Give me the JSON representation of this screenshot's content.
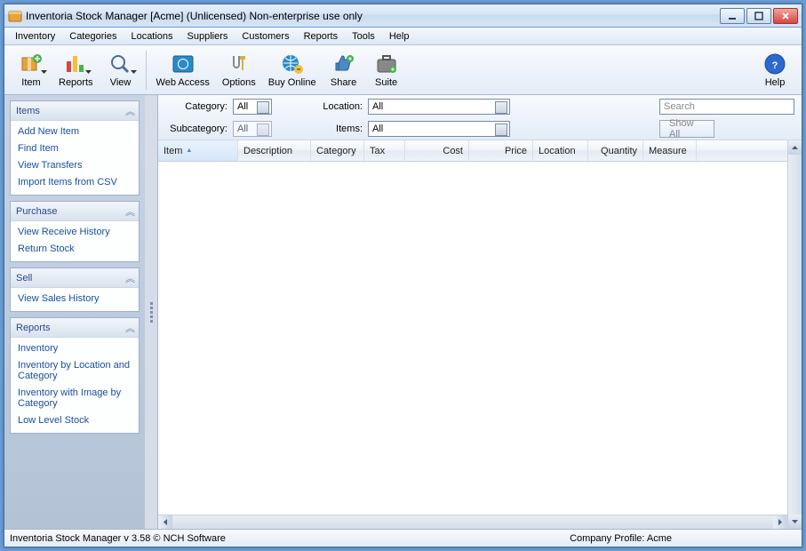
{
  "titlebar": {
    "text": "Inventoria Stock Manager [Acme] (Unlicensed) Non-enterprise use only"
  },
  "menubar": [
    "Inventory",
    "Categories",
    "Locations",
    "Suppliers",
    "Customers",
    "Reports",
    "Tools",
    "Help"
  ],
  "toolbar": {
    "item": "Item",
    "reports": "Reports",
    "view": "View",
    "web_access": "Web Access",
    "options": "Options",
    "buy_online": "Buy Online",
    "share": "Share",
    "suite": "Suite",
    "help": "Help"
  },
  "sidebar": {
    "items": {
      "title": "Items",
      "links": [
        "Add New Item",
        "Find Item",
        "View Transfers",
        "Import Items from CSV"
      ]
    },
    "purchase": {
      "title": "Purchase",
      "links": [
        "View Receive History",
        "Return Stock"
      ]
    },
    "sell": {
      "title": "Sell",
      "links": [
        "View Sales History"
      ]
    },
    "reports": {
      "title": "Reports",
      "links": [
        "Inventory",
        "Inventory by Location and Category",
        "Inventory with Image by Category",
        "Low Level Stock"
      ]
    }
  },
  "filters": {
    "category_label": "Category:",
    "category_value": "All",
    "location_label": "Location:",
    "location_value": "All",
    "subcategory_label": "Subcategory:",
    "subcategory_value": "All",
    "items_label": "Items:",
    "items_value": "All",
    "search_placeholder": "Search",
    "show_all": "Show All"
  },
  "grid": {
    "columns": [
      "Item",
      "Description",
      "Category",
      "Tax",
      "Cost",
      "Price",
      "Location",
      "Quantity",
      "Measure"
    ],
    "rows": []
  },
  "statusbar": {
    "left": "Inventoria Stock Manager v 3.58 © NCH Software",
    "right": "Company Profile: Acme"
  }
}
